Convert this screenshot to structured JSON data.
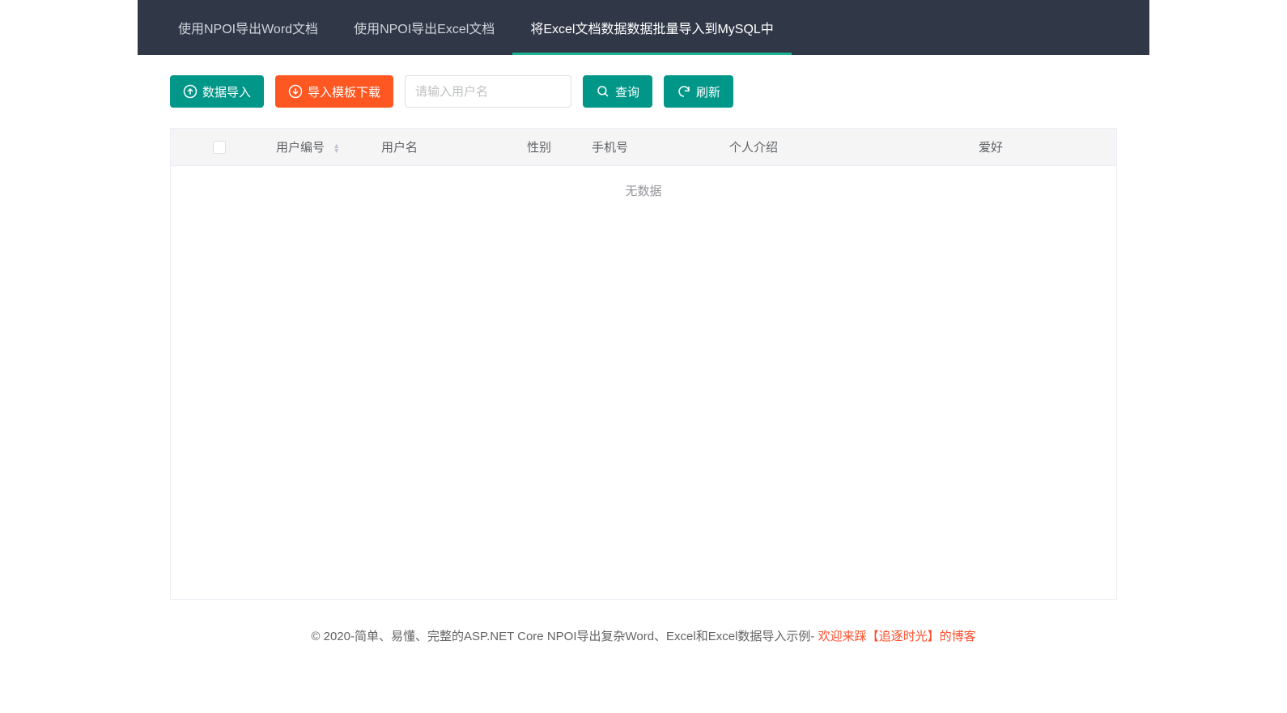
{
  "nav": {
    "tabs": [
      {
        "label": "使用NPOI导出Word文档",
        "active": false
      },
      {
        "label": "使用NPOI导出Excel文档",
        "active": false
      },
      {
        "label": "将Excel文档数据数据批量导入到MySQL中",
        "active": true
      }
    ]
  },
  "toolbar": {
    "import_label": "数据导入",
    "template_label": "导入模板下载",
    "search_placeholder": "请输入用户名",
    "search_value": "",
    "query_label": "查询",
    "refresh_label": "刷新"
  },
  "table": {
    "columns": {
      "user_id": "用户编号",
      "username": "用户名",
      "gender": "性别",
      "phone": "手机号",
      "intro": "个人介绍",
      "hobby": "爱好"
    },
    "no_data": "无数据"
  },
  "footer": {
    "text_left": "© 2020-简单、易懂、完整的ASP.NET Core NPOI导出复杂Word、Excel和Excel数据导入示例- ",
    "link_text": "欢迎来踩【追逐时光】的博客"
  }
}
